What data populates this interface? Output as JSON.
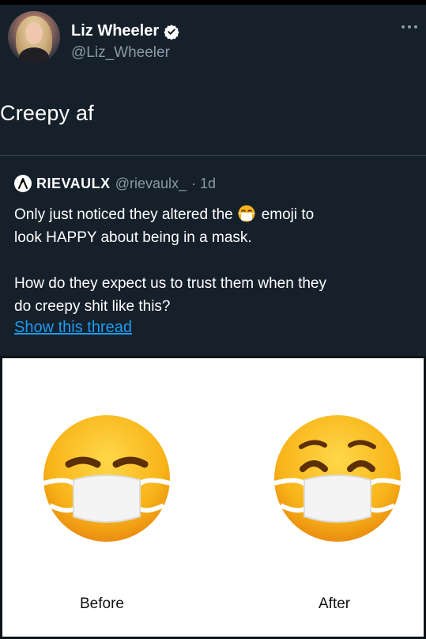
{
  "author": {
    "display_name": "Liz Wheeler",
    "handle": "@Liz_Wheeler",
    "verified": true,
    "avatar_icon": "profile-photo"
  },
  "tweet": {
    "text": "Creepy af"
  },
  "quoted_tweet": {
    "display_name": "RIEVAULX",
    "handle": "@rievaulx_",
    "time": "· 1d",
    "line1_before_emoji": "Only just noticed they altered the",
    "line1_emoji": "face-with-medical-mask-emoji",
    "line1_after_emoji": "emoji to",
    "line2": "look HAPPY about being in a mask.",
    "line3": "How do they expect us to trust them when they",
    "line4": "do creepy shit like this?",
    "show_thread_label": "Show this thread"
  },
  "media": {
    "before_label": "Before",
    "after_label": "After"
  },
  "colors": {
    "background": "#15202b",
    "secondary_text": "#8b98a5",
    "link": "#1d9bf0",
    "emoji_yellow": "#f9b21c"
  }
}
